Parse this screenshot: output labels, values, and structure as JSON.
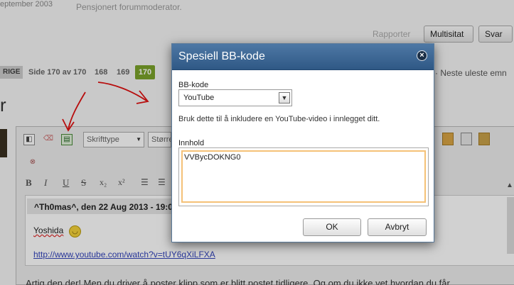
{
  "background": {
    "top_fragment": "eptember 2003",
    "user_title": "Pensjonert forummoderator.",
    "report_link": "Rapporter",
    "multiquote_button": "Multisitat",
    "reply_button": "Svar",
    "pagination": {
      "tag": "RIGE",
      "info": "Side 170 av 170",
      "pages": [
        "168",
        "169"
      ],
      "current": "170",
      "next_unread": "· Neste uleste emn"
    },
    "heading_fragment": "r",
    "toolbar": {
      "font_select": "Skrifttype",
      "size_select": "Størrel",
      "format_buttons": [
        "B",
        "I",
        "U",
        "S",
        "x₂",
        "x²"
      ]
    },
    "post": {
      "quote_header": "^Th0mas^, den 22 Aug 2013 - 19:0",
      "text": "Yoshida",
      "link": "http://www.youtube.com/watch?v=tUY6qXiLFXA",
      "reply_fragment": "Artig den der! Men du driver å poster klipp som er blitt postet tidligere. Og om du ikke vet hvordan du får"
    }
  },
  "dialog": {
    "title": "Spesiell BB-kode",
    "close_glyph": "×",
    "bbcode_label": "BB-kode",
    "bbcode_selected": "YouTube",
    "help_text": "Bruk dette til å inkludere en YouTube-video i innlegget ditt.",
    "content_label": "Innhold",
    "content_value": "VVBycDOKNG0",
    "ok_label": "OK",
    "cancel_label": "Avbryt"
  },
  "colors": {
    "dialog_header": "#3d6695",
    "page_current": "#7aa32a",
    "annotation": "#e01010",
    "textarea_focus": "#f5c177"
  }
}
